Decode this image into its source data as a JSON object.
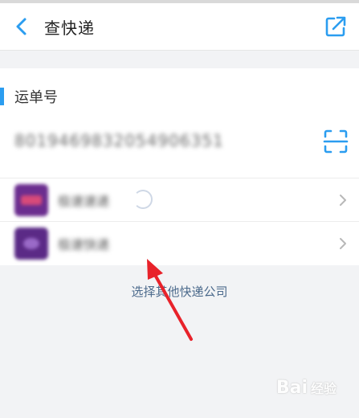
{
  "header": {
    "title": "查快递",
    "back_icon": "chevron-left-icon",
    "edit_icon": "edit-external-icon"
  },
  "tracking": {
    "section_label": "运单号",
    "number": "8019469832054906351",
    "scan_icon": "scan-icon"
  },
  "couriers": [
    {
      "name": "极速速递",
      "logo_color": "#6b2d8f"
    },
    {
      "name": "极速快递",
      "logo_color": "#5b2a86"
    }
  ],
  "footer": {
    "other_company_link": "选择其他快递公司"
  },
  "watermark": {
    "brand": "Bai",
    "sub": "经验"
  },
  "colors": {
    "accent": "#2b9df0",
    "annotation_arrow": "#e8222a"
  }
}
